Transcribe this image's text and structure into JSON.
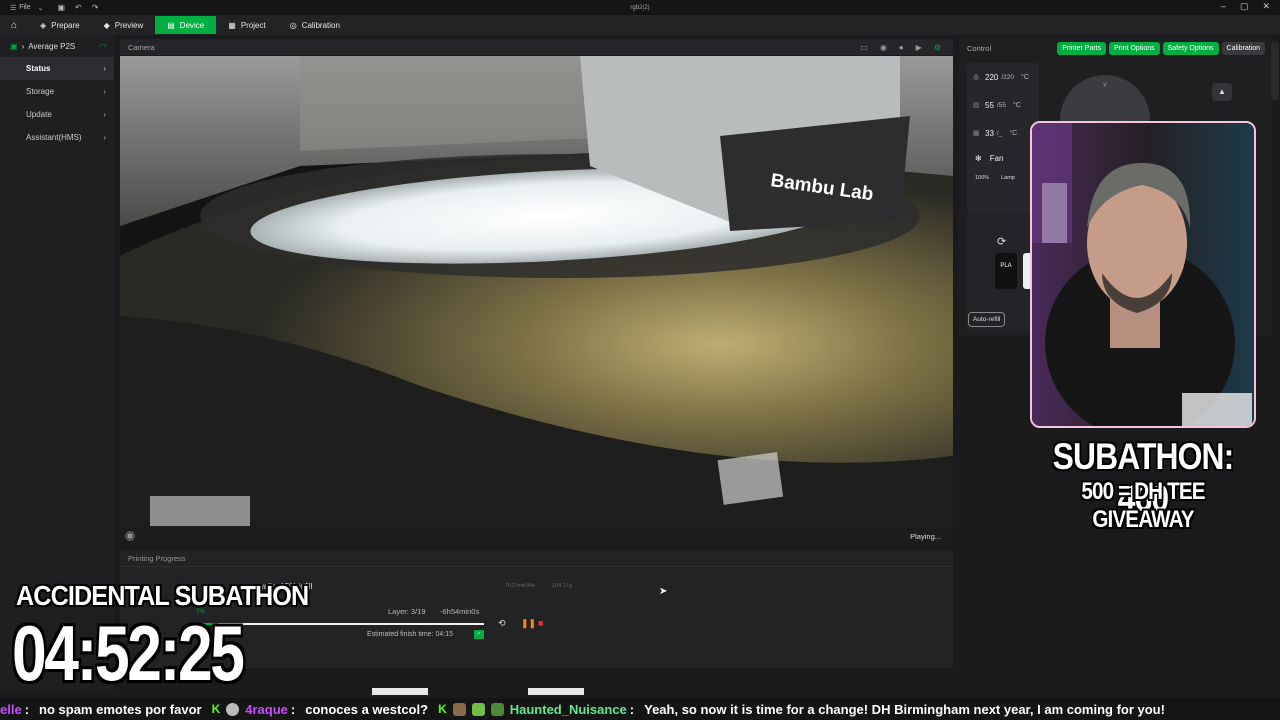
{
  "titlebar": {
    "file_label": "File",
    "window_title": "rgb2(2)"
  },
  "nav": {
    "tabs": [
      {
        "label": "Prepare"
      },
      {
        "label": "Preview"
      },
      {
        "label": "Device"
      },
      {
        "label": "Project"
      },
      {
        "label": "Calibration"
      }
    ],
    "active_tab": "Device"
  },
  "sidebar": {
    "printer_name": "Average P2S",
    "items": [
      {
        "label": "Status"
      },
      {
        "label": "Storage"
      },
      {
        "label": "Update"
      },
      {
        "label": "Assistant(HMS)"
      }
    ]
  },
  "camera": {
    "title": "Camera",
    "overlay_text": "Bambu Lab",
    "status": "Playing..."
  },
  "progress": {
    "title": "Printing Progress",
    "description": "walls, 15% infill",
    "time_small": "7h27min34s",
    "weight_small": "104.17g",
    "layer": "Layer: 3/19",
    "remaining": "-6h54min0s",
    "eta": "Estimated finish time: 04:15",
    "percent_value": 7,
    "percent_label": "7%"
  },
  "control": {
    "title": "Control",
    "buttons": [
      "Printer Parts",
      "Print Options",
      "Safety Options",
      "Calibration"
    ],
    "nozzle": {
      "current": "220",
      "target": "/220",
      "unit": "°C"
    },
    "bed": {
      "current": "55",
      "target": "/55",
      "unit": "°C"
    },
    "chamber": {
      "current": "33",
      "target": "/_",
      "unit": "°C"
    },
    "fan_label": "Fan",
    "fan_speed": "100%",
    "lamp_label": "Lamp",
    "dial_label": "Y",
    "ams_slot": "PLA",
    "auto_refill": "Auto-refill"
  },
  "overlay": {
    "subathon": "SUBATHON: 460",
    "goal": "500 = DH TEE GIVEAWAY",
    "accidental": "ACCIDENTAL SUBATHON",
    "timer": "04:52:25"
  },
  "chat": [
    {
      "user": "elle",
      "message": "no spam emotes por favor"
    },
    {
      "user": "4raque",
      "message": "conoces a westcol?"
    },
    {
      "user": "Haunted_Nuisance",
      "message": "Yeah, so now it is time for a change! DH Birmingham next year, I am coming for you!"
    }
  ],
  "colors": {
    "accent": "#00ae42",
    "chat_user_purple": "#c74dff",
    "chat_user_green": "#64e88c",
    "webcam_border": "#f3c6d9"
  }
}
